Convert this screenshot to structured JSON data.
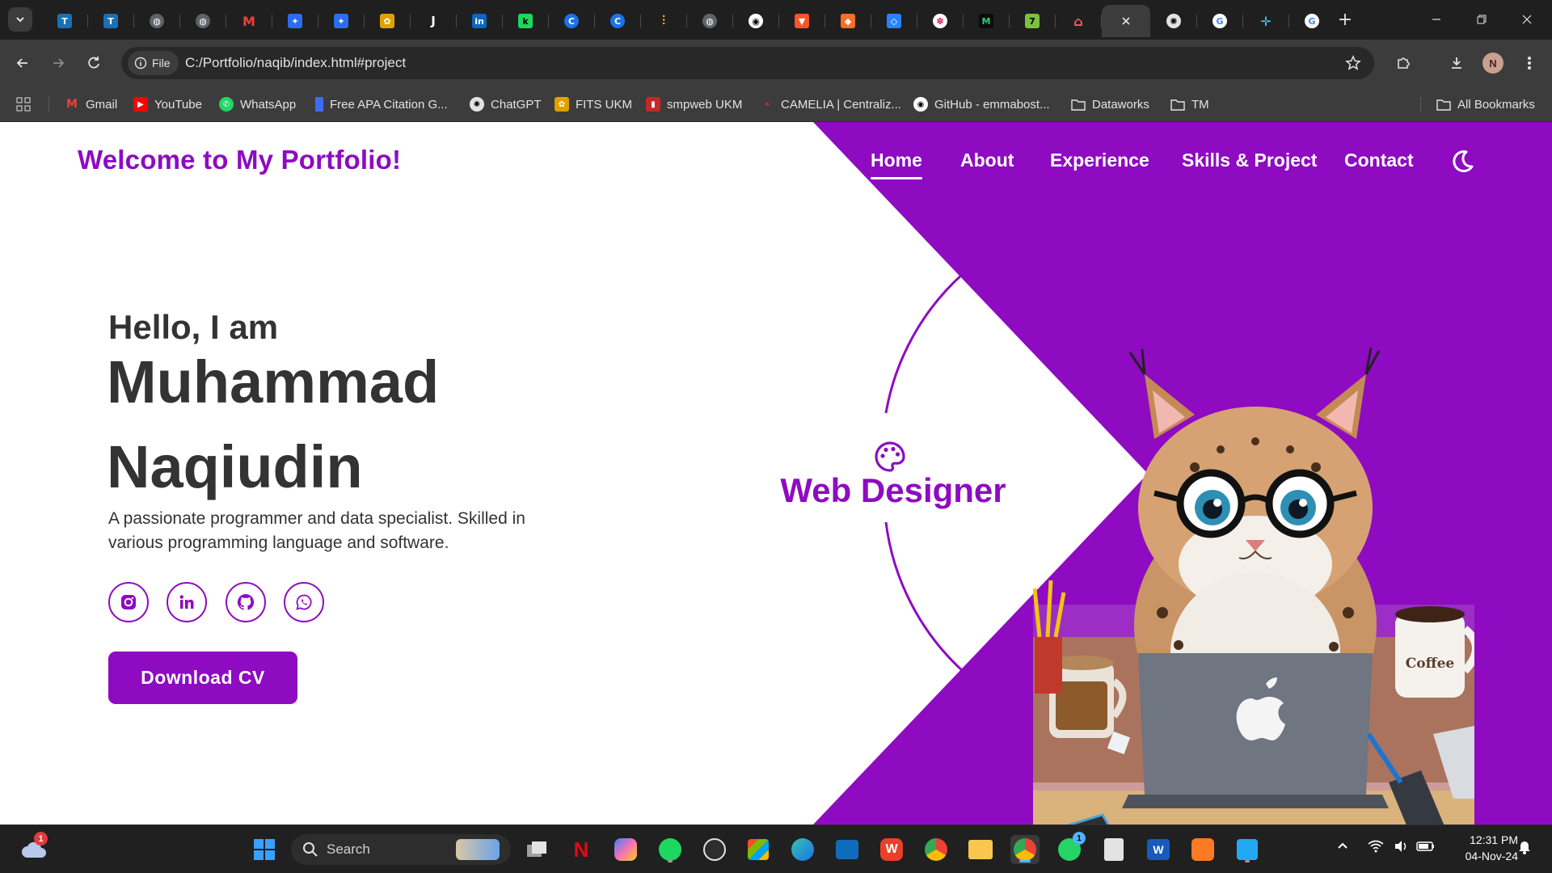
{
  "browser": {
    "tabs_count": 29,
    "address": {
      "scheme_label": "File",
      "url": "C:/Portfolio/naqib/index.html#project"
    },
    "profile_initial": "N",
    "bookmarks": [
      {
        "label": "Gmail",
        "icon": "gmail-icon"
      },
      {
        "label": "YouTube",
        "icon": "youtube-icon"
      },
      {
        "label": "WhatsApp",
        "icon": "whatsapp-icon"
      },
      {
        "label": "Free APA Citation G...",
        "icon": "bookmark-icon"
      },
      {
        "label": "ChatGPT",
        "icon": "chatgpt-icon"
      },
      {
        "label": "FITS UKM",
        "icon": "fits-icon"
      },
      {
        "label": "smpweb UKM",
        "icon": "smpweb-icon"
      },
      {
        "label": "CAMELIA | Centraliz...",
        "icon": "camelia-icon"
      },
      {
        "label": "GitHub - emmabost...",
        "icon": "github-icon"
      },
      {
        "label": "Dataworks",
        "icon": "folder-icon"
      },
      {
        "label": "TM",
        "icon": "folder-icon"
      }
    ],
    "all_bookmarks": "All Bookmarks"
  },
  "site": {
    "title": "Welcome to My Portfolio!",
    "nav": [
      "Home",
      "About",
      "Experience",
      "Skills & Project",
      "Contact"
    ],
    "active_nav": "Home",
    "accent": "#8e0bc1"
  },
  "hero": {
    "greeting": "Hello, I am",
    "name_line1": "Muhammad",
    "name_line2": "Naqiudin",
    "description": "A passionate programmer and data specialist. Skilled in various programming language and software.",
    "socials": [
      "instagram-icon",
      "linkedin-icon",
      "github-icon",
      "whatsapp-icon"
    ],
    "cv_button": "Download CV",
    "role": "Web Designer",
    "illustration_text": "Coffee"
  },
  "taskbar": {
    "search_placeholder": "Search",
    "weather_badge": "1",
    "whatsapp_badge": "1",
    "time": "12:31 PM",
    "date": "04-Nov-24"
  }
}
